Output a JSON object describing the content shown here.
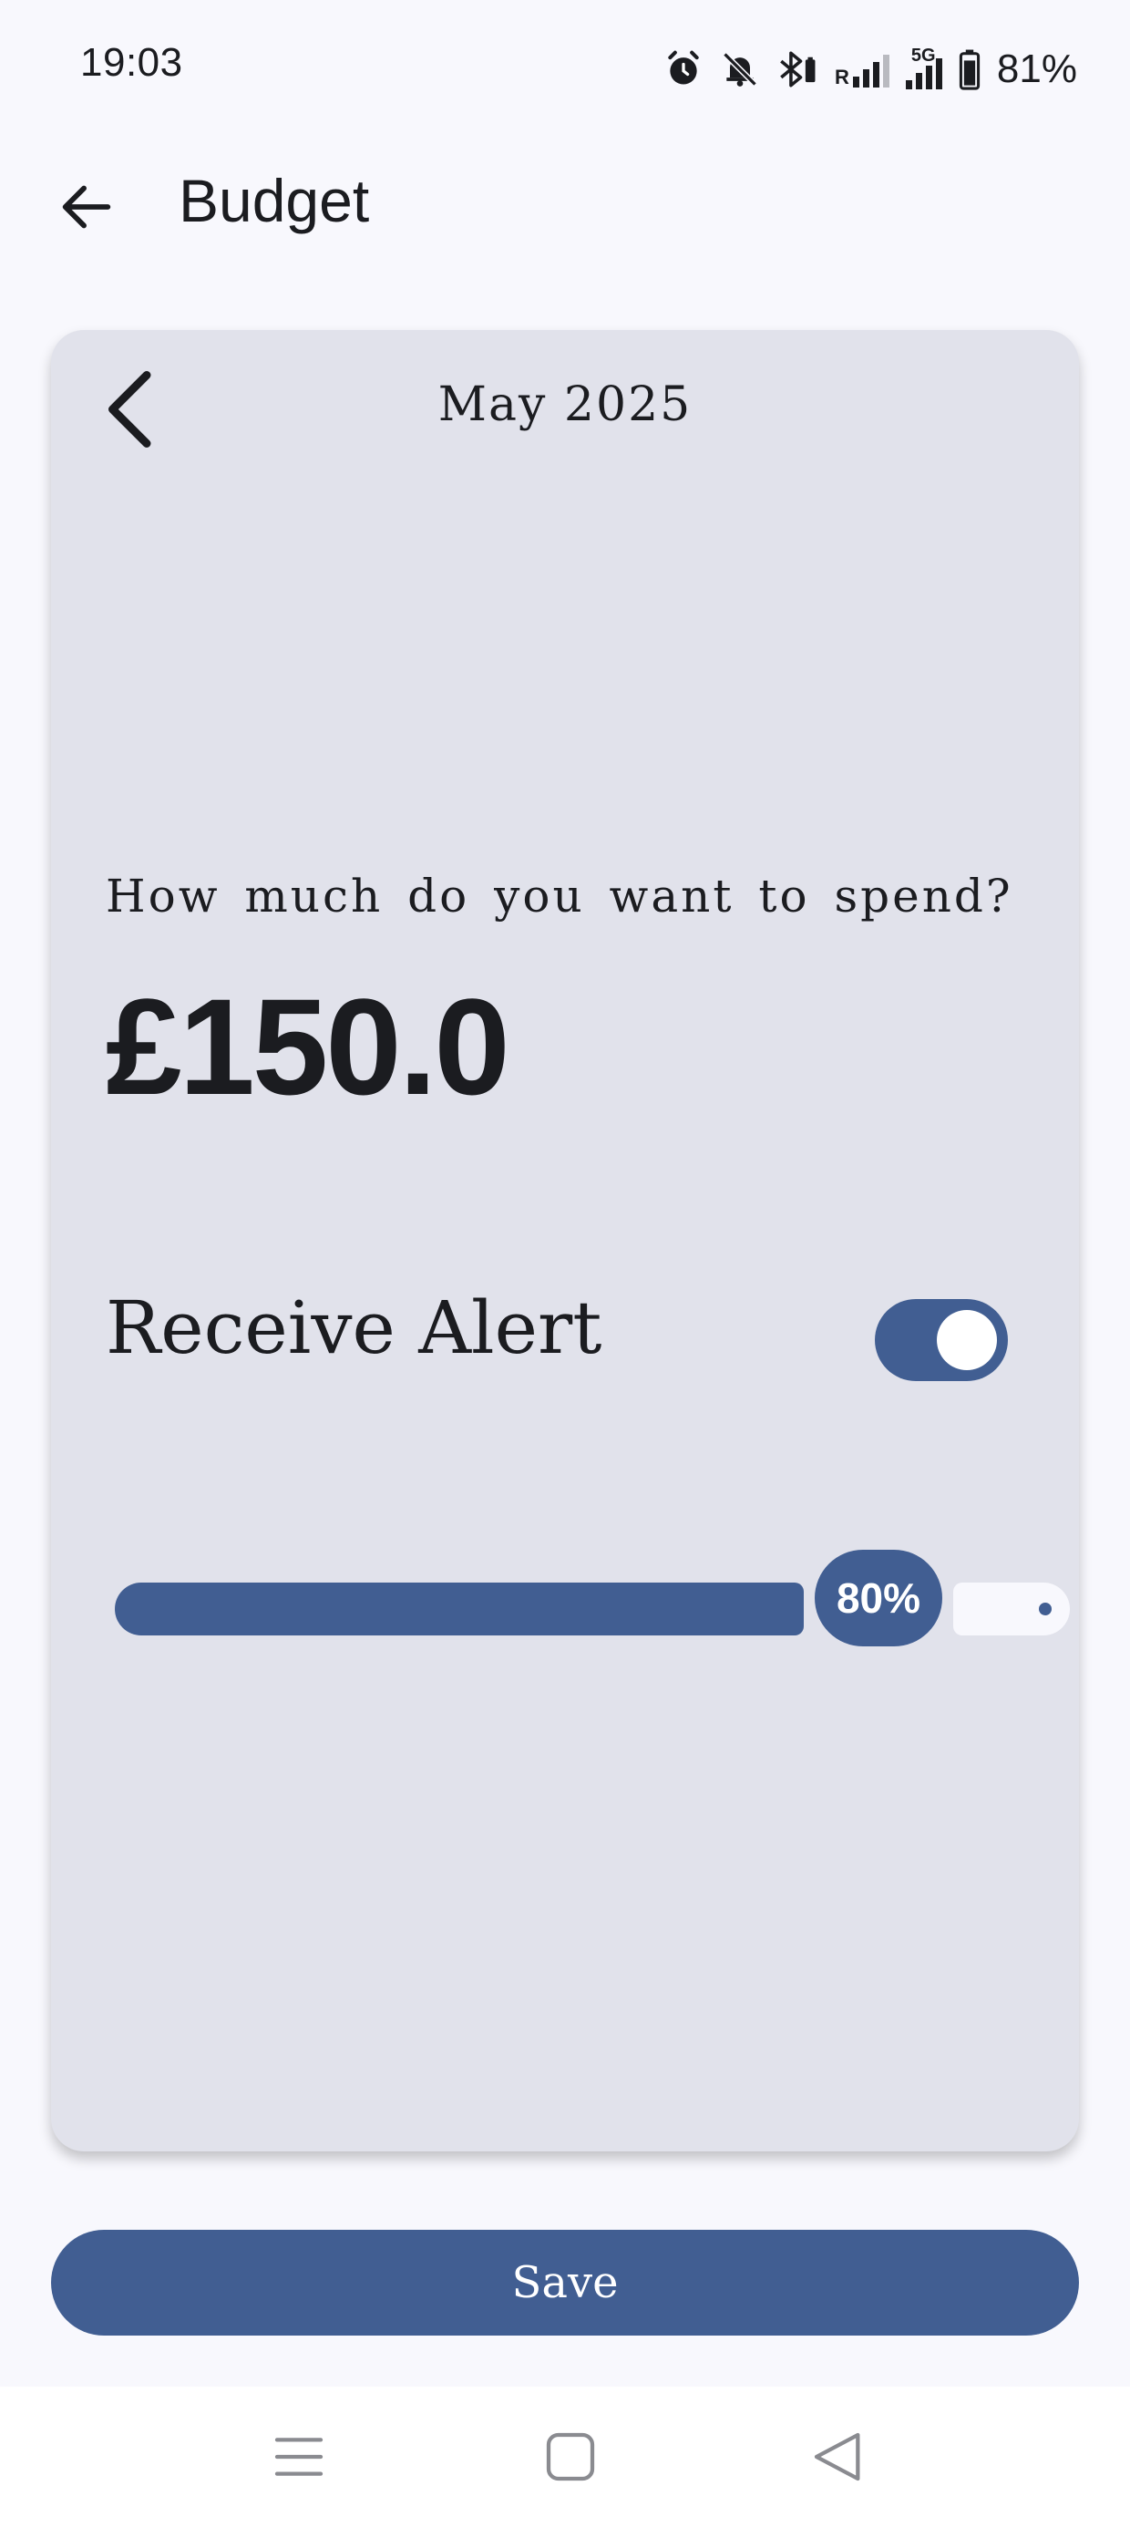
{
  "status_bar": {
    "time": "19:03",
    "network_label": "5G",
    "roaming_label": "R",
    "battery_percent": "81%",
    "icons": [
      "alarm-icon",
      "mute-icon",
      "bluetooth-icon",
      "signal-icon",
      "signal-5g-icon",
      "battery-icon"
    ]
  },
  "app_bar": {
    "title": "Budget",
    "back_icon": "arrow-left-icon"
  },
  "budget_card": {
    "month": "May 2025",
    "prev_icon": "chevron-left-icon",
    "prompt": "How much do you want to spend?",
    "amount": "£150.0",
    "alert_label": "Receive Alert",
    "alert_enabled": true,
    "alert_threshold_label": "80%",
    "alert_threshold_fraction": 0.8
  },
  "actions": {
    "save_label": "Save"
  },
  "nav_bar": {
    "buttons": [
      "menu-icon",
      "home-icon",
      "back-icon"
    ]
  },
  "colors": {
    "primary": "#415e92",
    "card_bg": "#e1e2eb",
    "page_bg": "#f8f8fd",
    "text": "#1b1c20"
  }
}
